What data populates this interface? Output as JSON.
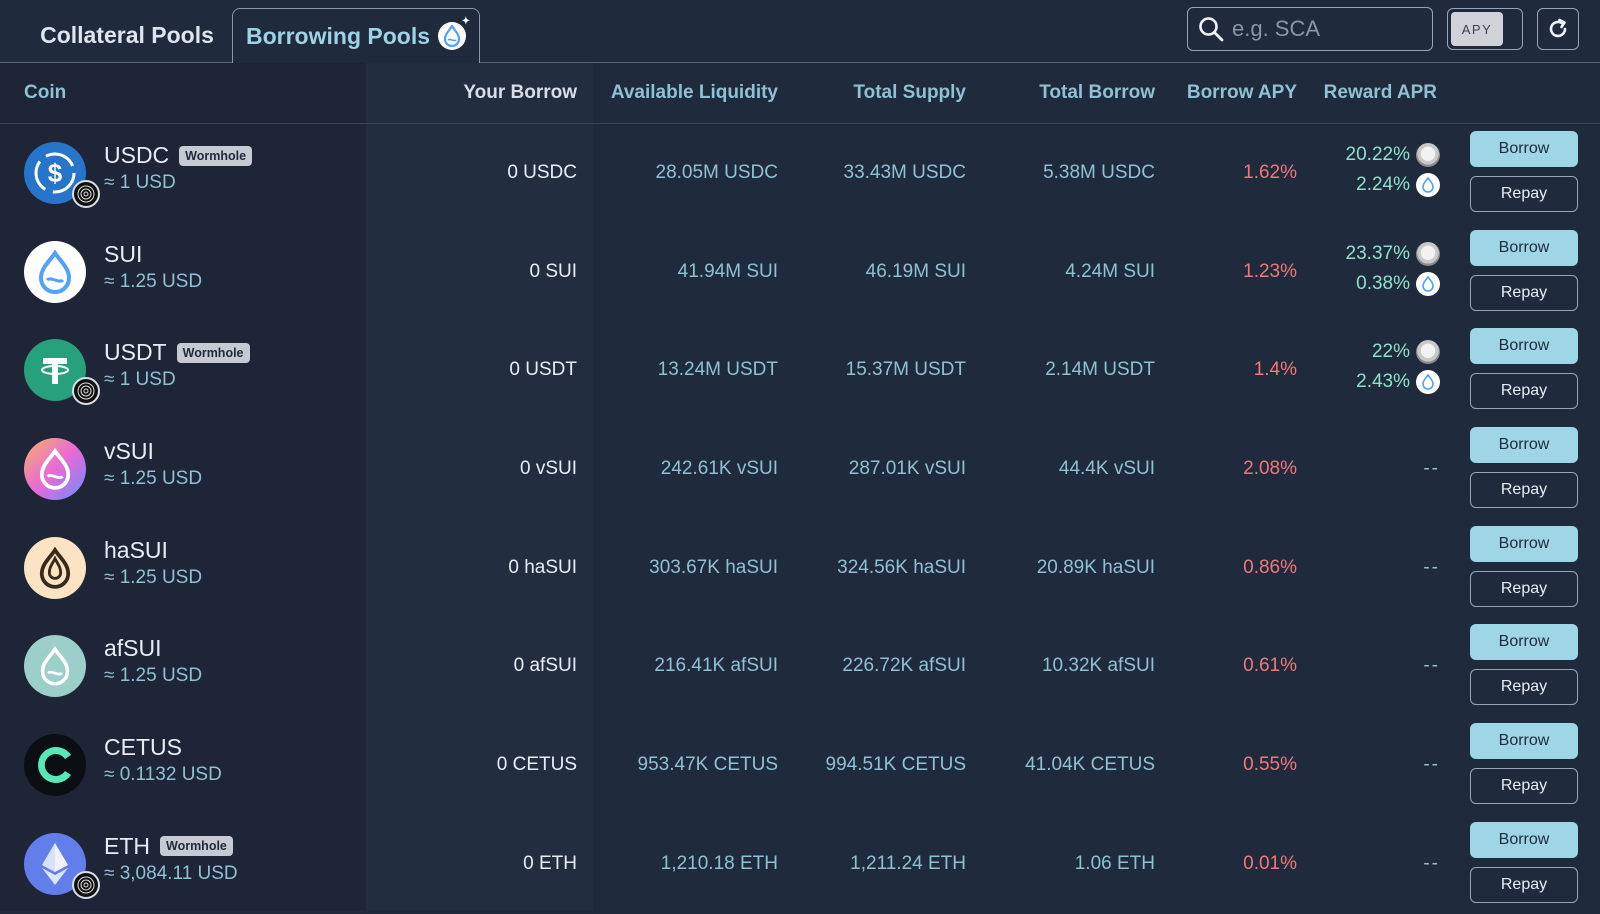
{
  "tabs": {
    "collateral": "Collateral Pools",
    "borrowing": "Borrowing Pools"
  },
  "search": {
    "placeholder": "e.g. SCA",
    "value": ""
  },
  "apy_toggle": {
    "label": "APY"
  },
  "table": {
    "headers": {
      "coin": "Coin",
      "your_borrow": "Your Borrow",
      "available_liquidity": "Available Liquidity",
      "total_supply": "Total Supply",
      "total_borrow": "Total Borrow",
      "borrow_apy": "Borrow APY",
      "reward_apr": "Reward APR"
    },
    "rows": [
      {
        "coin": "USDC",
        "badge": "Wormhole",
        "price": "≈ 1 USD",
        "your_borrow": "0 USDC",
        "available_liquidity": "28.05M USDC",
        "total_supply": "33.43M USDC",
        "total_borrow": "5.38M USDC",
        "borrow_apy": "1.62%",
        "reward_sca": "20.22%",
        "reward_sui": "2.24%",
        "reward_none": "",
        "borrow_label": "Borrow",
        "repay_label": "Repay"
      },
      {
        "coin": "SUI",
        "badge": "",
        "price": "≈ 1.25 USD",
        "your_borrow": "0 SUI",
        "available_liquidity": "41.94M SUI",
        "total_supply": "46.19M SUI",
        "total_borrow": "4.24M SUI",
        "borrow_apy": "1.23%",
        "reward_sca": "23.37%",
        "reward_sui": "0.38%",
        "reward_none": "",
        "borrow_label": "Borrow",
        "repay_label": "Repay"
      },
      {
        "coin": "USDT",
        "badge": "Wormhole",
        "price": "≈ 1 USD",
        "your_borrow": "0 USDT",
        "available_liquidity": "13.24M USDT",
        "total_supply": "15.37M USDT",
        "total_borrow": "2.14M USDT",
        "borrow_apy": "1.4%",
        "reward_sca": "22%",
        "reward_sui": "2.43%",
        "reward_none": "",
        "borrow_label": "Borrow",
        "repay_label": "Repay"
      },
      {
        "coin": "vSUI",
        "badge": "",
        "price": "≈ 1.25 USD",
        "your_borrow": "0 vSUI",
        "available_liquidity": "242.61K vSUI",
        "total_supply": "287.01K vSUI",
        "total_borrow": "44.4K vSUI",
        "borrow_apy": "2.08%",
        "reward_sca": "",
        "reward_sui": "",
        "reward_none": "--",
        "borrow_label": "Borrow",
        "repay_label": "Repay"
      },
      {
        "coin": "haSUI",
        "badge": "",
        "price": "≈ 1.25 USD",
        "your_borrow": "0 haSUI",
        "available_liquidity": "303.67K haSUI",
        "total_supply": "324.56K haSUI",
        "total_borrow": "20.89K haSUI",
        "borrow_apy": "0.86%",
        "reward_sca": "",
        "reward_sui": "",
        "reward_none": "--",
        "borrow_label": "Borrow",
        "repay_label": "Repay"
      },
      {
        "coin": "afSUI",
        "badge": "",
        "price": "≈ 1.25 USD",
        "your_borrow": "0 afSUI",
        "available_liquidity": "216.41K afSUI",
        "total_supply": "226.72K afSUI",
        "total_borrow": "10.32K afSUI",
        "borrow_apy": "0.61%",
        "reward_sca": "",
        "reward_sui": "",
        "reward_none": "--",
        "borrow_label": "Borrow",
        "repay_label": "Repay"
      },
      {
        "coin": "CETUS",
        "badge": "",
        "price": "≈ 0.1132 USD",
        "your_borrow": "0 CETUS",
        "available_liquidity": "953.47K CETUS",
        "total_supply": "994.51K CETUS",
        "total_borrow": "41.04K CETUS",
        "borrow_apy": "0.55%",
        "reward_sca": "",
        "reward_sui": "",
        "reward_none": "--",
        "borrow_label": "Borrow",
        "repay_label": "Repay"
      },
      {
        "coin": "ETH",
        "badge": "Wormhole",
        "price": "≈ 3,084.11 USD",
        "your_borrow": "0 ETH",
        "available_liquidity": "1,210.18 ETH",
        "total_supply": "1,211.24 ETH",
        "total_borrow": "1.06 ETH",
        "borrow_apy": "0.01%",
        "reward_sca": "",
        "reward_sui": "",
        "reward_none": "--",
        "borrow_label": "Borrow",
        "repay_label": "Repay"
      }
    ]
  },
  "icons": {
    "usdc": "usdc-icon",
    "sui": "sui-icon",
    "usdt": "usdt-icon",
    "vsui": "vsui-icon",
    "hasui": "hasui-icon",
    "afsui": "afsui-icon",
    "cetus": "cetus-icon",
    "eth": "eth-icon",
    "bridge": "wormhole-bridge-icon",
    "search": "search-icon",
    "refresh": "refresh-icon",
    "sca_reward": "sca-reward-icon",
    "sui_reward": "sui-reward-icon"
  },
  "colors": {
    "background": "#1f2a3c",
    "accent": "#9ed6e6",
    "apy_red": "#f07878",
    "reward_green": "#8fe0c8"
  }
}
